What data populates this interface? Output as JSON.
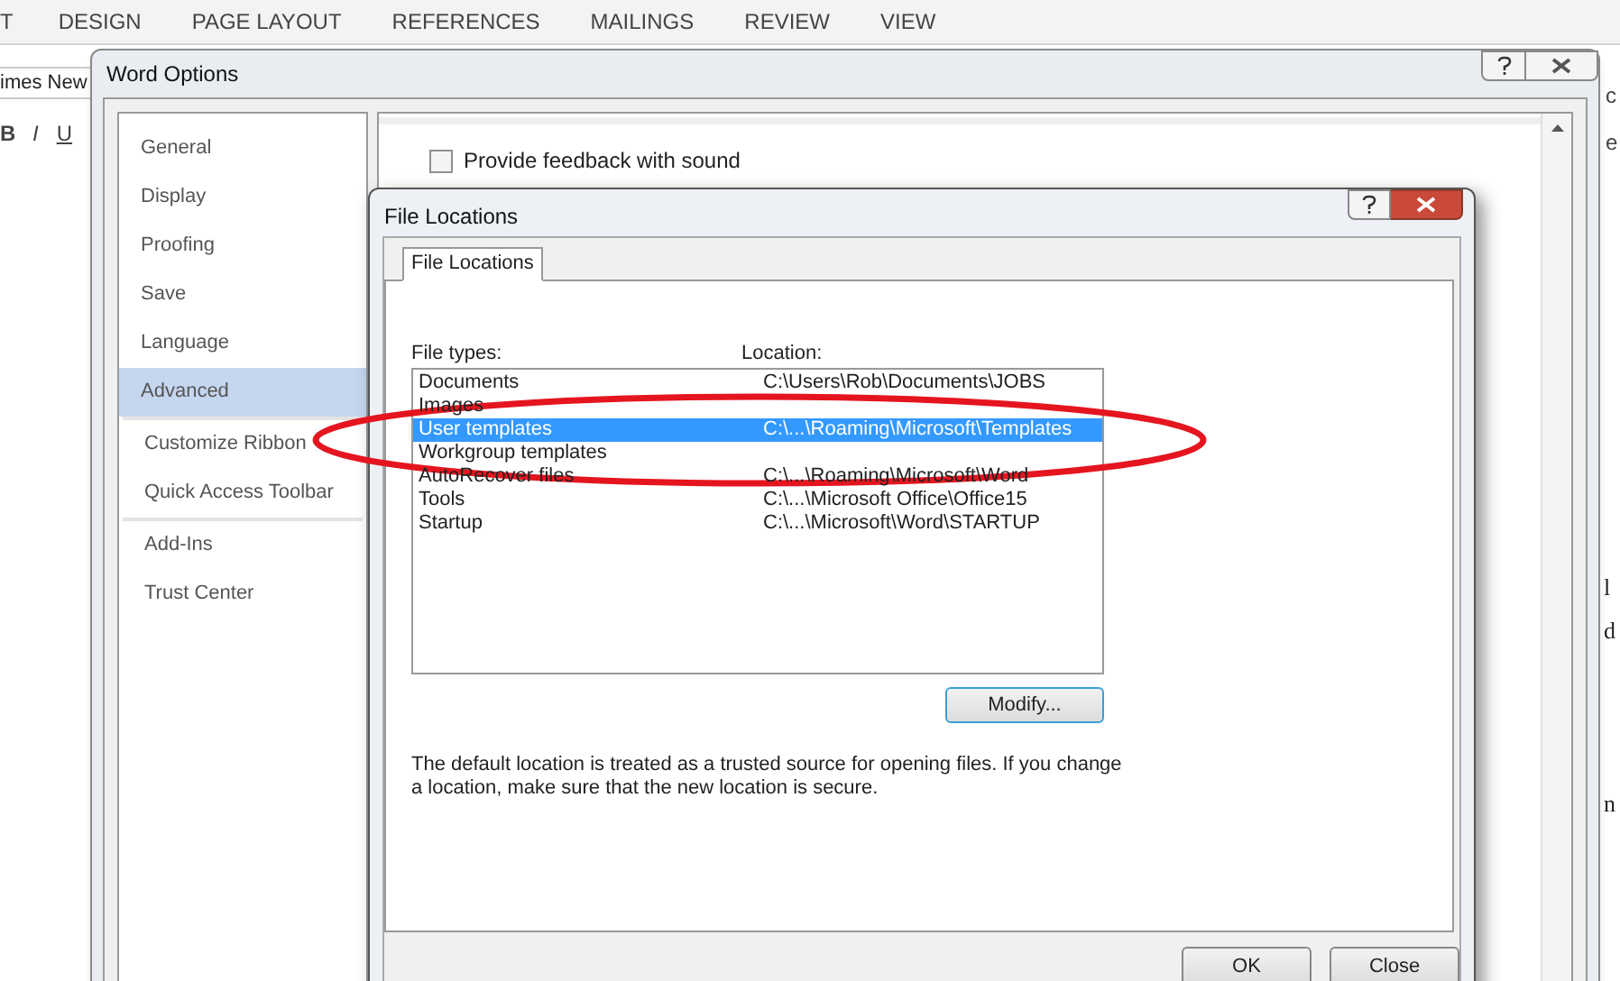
{
  "word": {
    "ribbon_tabs": [
      "T",
      "DESIGN",
      "PAGE LAYOUT",
      "REFERENCES",
      "MAILINGS",
      "REVIEW",
      "VIEW"
    ],
    "font_name": "imes New",
    "format_buttons": [
      "B",
      "I",
      "U"
    ],
    "ribbon_fragments": [
      "c",
      "e"
    ],
    "document_fragments": [
      "l",
      "d",
      "n"
    ]
  },
  "options": {
    "title": "Word Options",
    "sidebar": [
      [
        {
          "label": "General",
          "selected": false
        },
        {
          "label": "Display",
          "selected": false
        },
        {
          "label": "Proofing",
          "selected": false
        },
        {
          "label": "Save",
          "selected": false
        },
        {
          "label": "Language",
          "selected": false
        },
        {
          "label": "Advanced",
          "selected": true
        }
      ],
      [
        {
          "label": "Customize Ribbon",
          "selected": false
        },
        {
          "label": "Quick Access Toolbar",
          "selected": false
        }
      ],
      [
        {
          "label": "Add-Ins",
          "selected": false
        },
        {
          "label": "Trust Center",
          "selected": false
        }
      ]
    ],
    "checkboxes": [
      {
        "label": "Provide feedback with sound",
        "checked": false
      }
    ]
  },
  "dialog": {
    "title": "File Locations",
    "tabs": [
      {
        "label": "File Locations",
        "selected": true
      }
    ],
    "columns": [
      "File types:",
      "Location:"
    ],
    "rows": [
      {
        "type": "Documents",
        "location": "C:\\Users\\Rob\\Documents\\JOBS",
        "selected": false
      },
      {
        "type": "Images",
        "location": "",
        "selected": false
      },
      {
        "type": "User templates",
        "location": "C:\\...\\Roaming\\Microsoft\\Templates",
        "selected": true
      },
      {
        "type": "Workgroup templates",
        "location": "",
        "selected": false
      },
      {
        "type": "AutoRecover files",
        "location": "C:\\...\\Roaming\\Microsoft\\Word",
        "selected": false
      },
      {
        "type": "Tools",
        "location": "C:\\...\\Microsoft Office\\Office15",
        "selected": false
      },
      {
        "type": "Startup",
        "location": "C:\\...\\Microsoft\\Word\\STARTUP",
        "selected": false
      }
    ],
    "modify_button": "Modify...",
    "note": "The default location is treated as a trusted source for opening files. If you change a location, make sure that the new location is secure.",
    "buttons": [
      "OK",
      "Close"
    ]
  }
}
